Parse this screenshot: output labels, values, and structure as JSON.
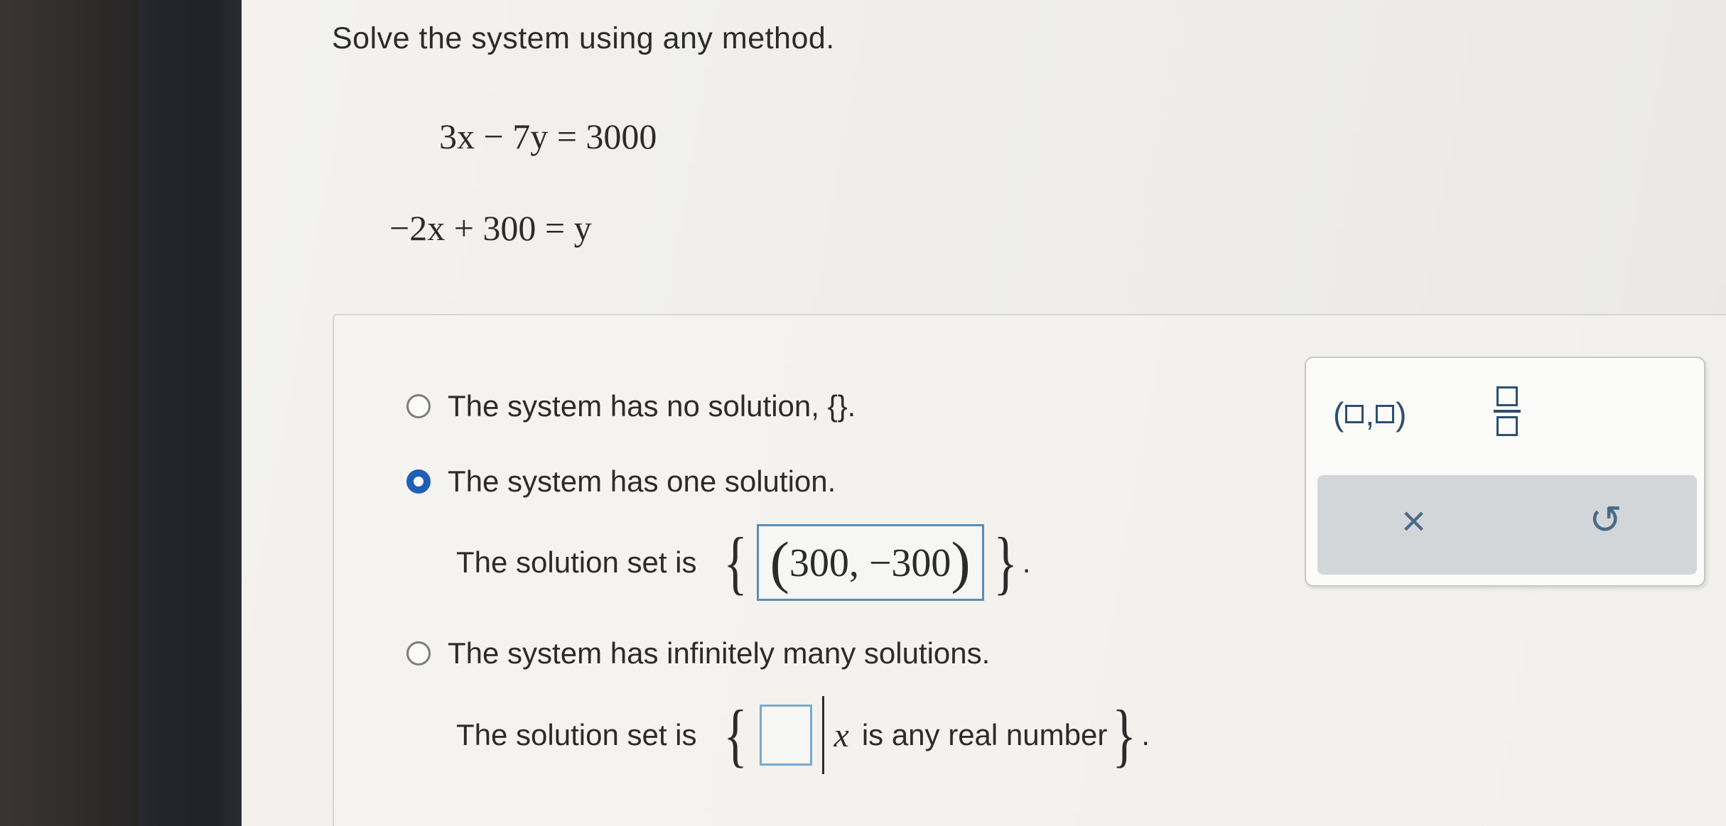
{
  "question": {
    "prompt": "Solve the system using any method."
  },
  "system": {
    "equation_1": "3x − 7y = 3000",
    "equation_2": "−2x + 300 = y"
  },
  "options": [
    {
      "label": "The system has no solution, {}.",
      "selected": false
    },
    {
      "label": "The system has one solution.",
      "selected": true
    },
    {
      "label": "The system has infinitely many solutions.",
      "selected": false
    }
  ],
  "one_solution": {
    "prefix": "The solution set is",
    "answer": "300, −300",
    "suffix": "."
  },
  "infinite_solutions": {
    "prefix": "The solution set is",
    "variable": "x",
    "condition": "is any real number",
    "suffix": "."
  },
  "toolbox": {
    "ordered_pair_icon": "ordered-pair-icon",
    "fraction_icon": "fraction-icon",
    "clear_icon": "close-icon",
    "undo_icon": "undo-icon",
    "clear_glyph": "×",
    "undo_glyph": "↺"
  }
}
